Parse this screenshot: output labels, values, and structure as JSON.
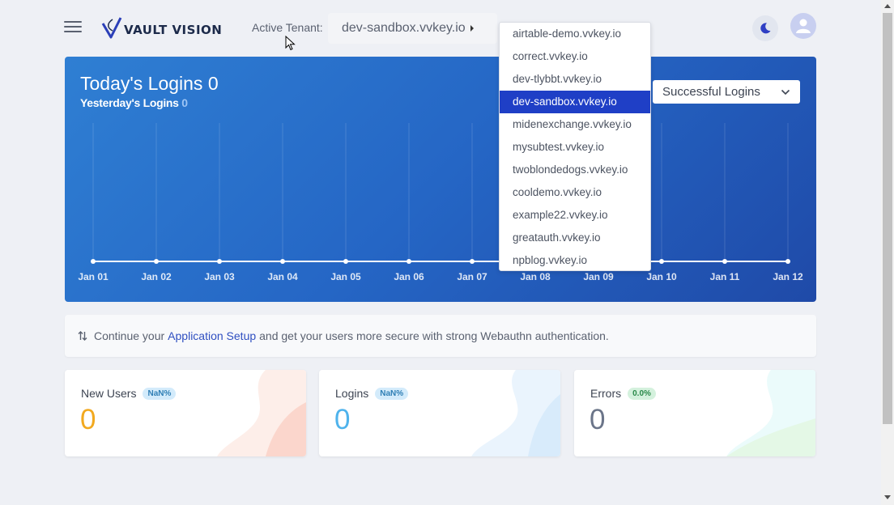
{
  "header": {
    "logo_text": "VAULT VISION",
    "tenant_label": "Active Tenant:",
    "tenant_value": "dev-sandbox.vvkey.io"
  },
  "dropdown": {
    "items": [
      "airtable-demo.vvkey.io",
      "correct.vvkey.io",
      "dev-tlybbt.vvkey.io",
      "dev-sandbox.vvkey.io",
      "midenexchange.vvkey.io",
      "mysubtest.vvkey.io",
      "twoblondedogs.vvkey.io",
      "cooldemo.vvkey.io",
      "example22.vvkey.io",
      "greatauth.vvkey.io",
      "npblog.vvkey.io"
    ],
    "selected_index": 3
  },
  "chart": {
    "title": "Today's Logins 0",
    "yesterday_label": "Yesterday's Logins",
    "yesterday_value": "0",
    "metric_select": "Successful Logins"
  },
  "chart_data": {
    "type": "line",
    "categories": [
      "Jan 01",
      "Jan 02",
      "Jan 03",
      "Jan 04",
      "Jan 05",
      "Jan 06",
      "Jan 07",
      "Jan 08",
      "Jan 09",
      "Jan 10",
      "Jan 11",
      "Jan 12"
    ],
    "series": [
      {
        "values": [
          0,
          0,
          0,
          0,
          0,
          0,
          0,
          0,
          0,
          0,
          0,
          0
        ]
      }
    ],
    "grid": true
  },
  "banner": {
    "prefix": "Continue your",
    "link": "Application Setup",
    "suffix": "and get your users more secure with strong Webauthn authentication."
  },
  "stats": [
    {
      "label": "New Users",
      "badge": "NaN%",
      "value": "0",
      "color": "#f2a91f"
    },
    {
      "label": "Logins",
      "badge": "NaN%",
      "value": "0",
      "color": "#4fb3ec"
    },
    {
      "label": "Errors",
      "badge": "0.0%",
      "value": "0",
      "color": "#6b7589"
    }
  ]
}
